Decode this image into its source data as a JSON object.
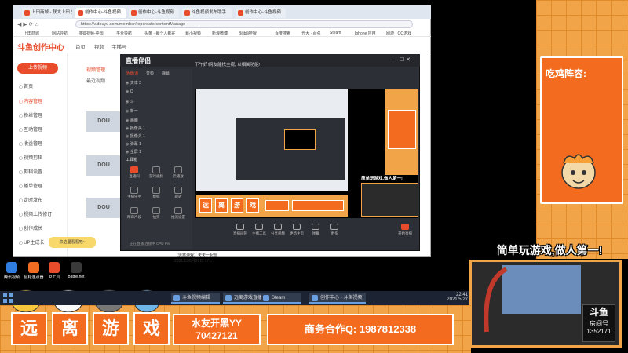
{
  "browser": {
    "tabs": [
      {
        "label": "上田商城 - 联大上田 头条"
      },
      {
        "label": "创作中心-斗鱼视频"
      },
      {
        "label": "创作中心-斗鱼视频"
      },
      {
        "label": "斗鱼视频发布助手"
      },
      {
        "label": "创作中心-斗鱼视频"
      }
    ],
    "url": "https://v.douyu.com/member/repcreate/contentManage",
    "bookmarks": [
      "上田商城",
      "网站导航",
      "搜狐视频-中国",
      "平台导航",
      "头条 · 每个人都在",
      "暴小视频",
      "新浪微博",
      "Bilibili哔哩",
      "百度搜索",
      "光大 · 百强",
      "Steam",
      "Iphone 应用",
      "网游 · QQ游戏"
    ]
  },
  "site": {
    "logo": "斗鱼创作中心",
    "nav": [
      "首页",
      "视频",
      "主播号"
    ],
    "upload_button": "上传视频",
    "sidebar": [
      {
        "label": "首页",
        "active": false
      },
      {
        "label": "内容管理",
        "active": true
      },
      {
        "label": "粉丝管理",
        "active": false
      },
      {
        "label": "互动管理",
        "active": false
      },
      {
        "label": "收益管理",
        "active": false
      },
      {
        "label": "视频剪辑",
        "active": false
      },
      {
        "label": "剪辑设置",
        "active": false
      },
      {
        "label": "播单管理",
        "active": false
      },
      {
        "label": "定时发布",
        "active": false
      },
      {
        "label": "视频上传修订",
        "active": false
      },
      {
        "label": "创作成长",
        "active": false
      },
      {
        "label": "UP主成长",
        "active": false
      }
    ],
    "content_tabs": [
      "视频管理",
      "最近视频"
    ],
    "thumb_label": "DOU",
    "tooltip": "来这里看看吧~"
  },
  "obs": {
    "title": "直播伴侣",
    "hint": "下午好!网友能找主视, 以相关功能!",
    "left_tabs": [
      {
        "label": "场景/源",
        "active": true
      },
      {
        "label": "音频",
        "active": false
      },
      {
        "label": "弹幕",
        "active": false
      }
    ],
    "layers": [
      "文本 5",
      "Q",
      "斗",
      "新一",
      "画面",
      "摄像头 1",
      "摄像头 1",
      "弹幕 1",
      "全屏 1"
    ],
    "tools_label": "工具箱",
    "tools": [
      {
        "label": "直播间",
        "hot": true
      },
      {
        "label": "游戏视频",
        "hot": false
      },
      {
        "label": "云播放",
        "hot": false
      },
      {
        "label": "主播任务",
        "hot": false
      },
      {
        "label": "数据",
        "hot": false
      },
      {
        "label": "跳转",
        "hot": false
      },
      {
        "label": "精彩片段",
        "hot": false
      },
      {
        "label": "抽奖",
        "hot": false
      },
      {
        "label": "推流设置",
        "hot": false
      }
    ],
    "bottom_controls": [
      "直播间管",
      "主播工具",
      "分享视频",
      "更新主页",
      "弹幕",
      "更多",
      "开始直播"
    ],
    "status": "正在直播 连接中 CPU 6%",
    "preview_tiles": [
      "远",
      "离",
      "游",
      "戏"
    ],
    "preview_slogan": "简单玩游戏,做人第一!"
  },
  "file_info": {
    "name": "【远离游戏】天天一起玩",
    "date": "2021年05月26日 17:..."
  },
  "desktop_icons": [
    {
      "label": "腾讯视频",
      "color": "#2f7de1"
    },
    {
      "label": "鼠标连点器",
      "color": "#f26d21"
    },
    {
      "label": "IP工具",
      "color": "#e84c2b"
    },
    {
      "label": "Battle.net",
      "color": "#3a3a3a"
    }
  ],
  "taskbar": {
    "items": [
      "斗鱼视频编辑",
      "远离游戏直播",
      "Steam",
      "创作中心 - 斗鱼视频"
    ],
    "time": "22:41",
    "date": "2021/5/27"
  },
  "overlay": {
    "chat_title": "吃鸡阵容:",
    "slogan": "简单玩游戏,做人第一!",
    "tiles": [
      "远",
      "离",
      "游",
      "戏"
    ],
    "fan_group_line1": "水友开黑YY",
    "fan_group_line2": "70427121",
    "business": "商务合作Q: 1987812338",
    "room_label": "房间号",
    "room_number": "1352171",
    "douyu_mark": "斗鱼"
  },
  "colors": {
    "overlay_orange": "#f36b1f",
    "panel_orange": "#f2a548",
    "brand_red": "#e84c2b"
  }
}
